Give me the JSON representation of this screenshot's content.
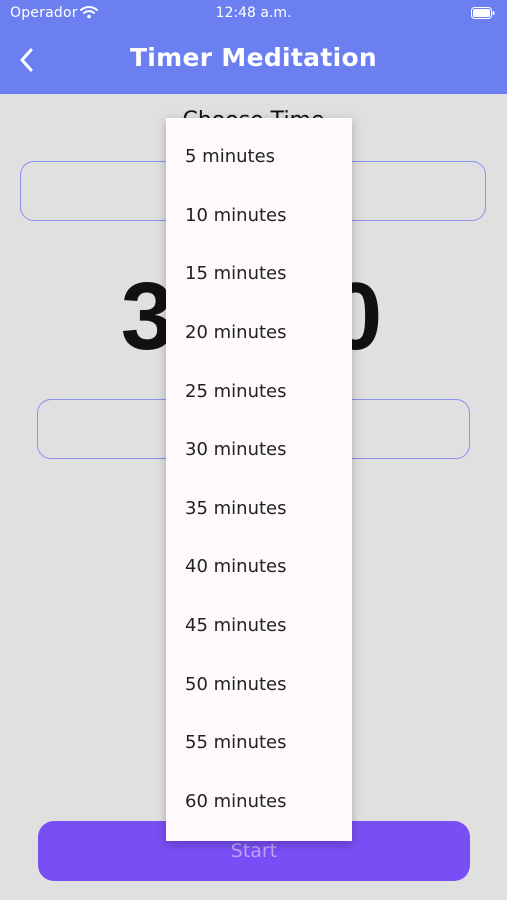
{
  "status_bar": {
    "carrier": "Operador",
    "time": "12:48 a.m."
  },
  "header": {
    "title": "Timer Meditation"
  },
  "main": {
    "choose_label": "Choose Time",
    "time_display": "30:00"
  },
  "start_button": {
    "label": "Start"
  },
  "dropdown": {
    "options": [
      "5 minutes",
      "10 minutes",
      "15 minutes",
      "20 minutes",
      "25 minutes",
      "30 minutes",
      "35 minutes",
      "40 minutes",
      "45 minutes",
      "50 minutes",
      "55 minutes",
      "60 minutes"
    ]
  },
  "colors": {
    "header_bg": "#6b7ff0",
    "page_bg": "#e0e0e0",
    "start_button_bg": "#7a4ef5",
    "outline": "#8a8ff0",
    "menu_bg": "#fdf9fc"
  },
  "icons": {
    "back": "chevron-left-icon",
    "wifi": "wifi-icon",
    "battery": "battery-icon"
  }
}
